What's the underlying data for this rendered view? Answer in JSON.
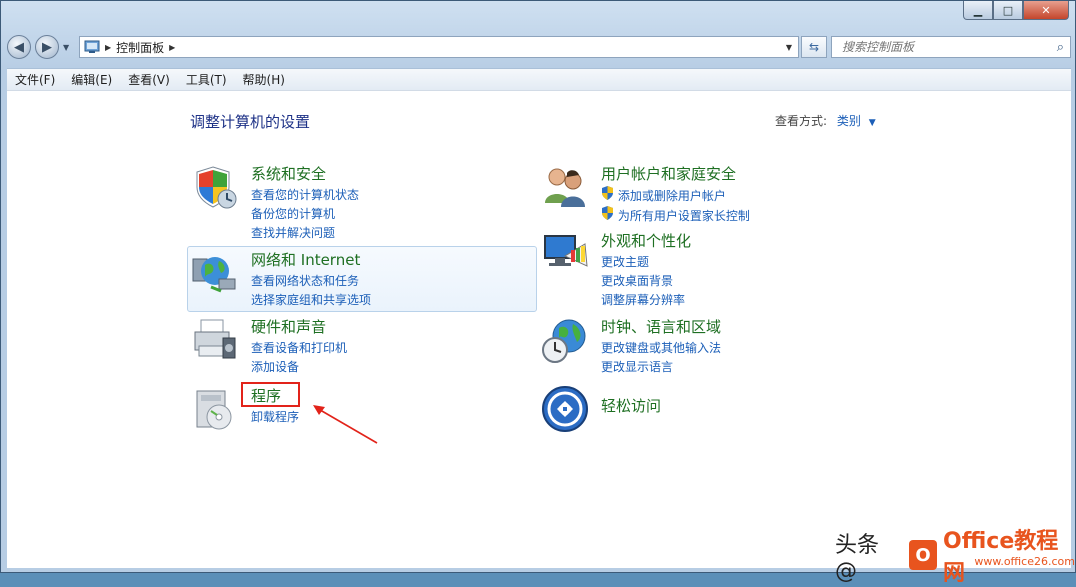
{
  "window": {
    "minimize_glyph": "▁",
    "maximize_glyph": "□",
    "close_glyph": "✕"
  },
  "nav": {
    "breadcrumb": "控制面板",
    "search_placeholder": "搜索控制面板"
  },
  "menu": [
    "文件(F)",
    "编辑(E)",
    "查看(V)",
    "工具(T)",
    "帮助(H)"
  ],
  "page": {
    "title": "调整计算机的设置",
    "viewby_label": "查看方式:",
    "viewby_value": "类别"
  },
  "categories": {
    "system": {
      "title": "系统和安全",
      "links": [
        "查看您的计算机状态",
        "备份您的计算机",
        "查找并解决问题"
      ]
    },
    "network": {
      "title": "网络和 Internet",
      "links": [
        "查看网络状态和任务",
        "选择家庭组和共享选项"
      ]
    },
    "hardware": {
      "title": "硬件和声音",
      "links": [
        "查看设备和打印机",
        "添加设备"
      ]
    },
    "programs": {
      "title": "程序",
      "links": [
        "卸载程序"
      ]
    },
    "users": {
      "title": "用户帐户和家庭安全",
      "links": [
        "添加或删除用户帐户",
        "为所有用户设置家长控制"
      ]
    },
    "appearance": {
      "title": "外观和个性化",
      "links": [
        "更改主题",
        "更改桌面背景",
        "调整屏幕分辨率"
      ]
    },
    "clock": {
      "title": "时钟、语言和区域",
      "links": [
        "更改键盘或其他输入法",
        "更改显示语言"
      ]
    },
    "ease": {
      "title": "轻松访问",
      "links": []
    }
  },
  "watermark": {
    "text": "头条 @",
    "logo": "O",
    "site": "Office教程网",
    "url": "www.office26.com"
  },
  "colors": {
    "category_title": "#1e6f22",
    "link": "#1c5fb8",
    "annotation": "#e2231a"
  }
}
